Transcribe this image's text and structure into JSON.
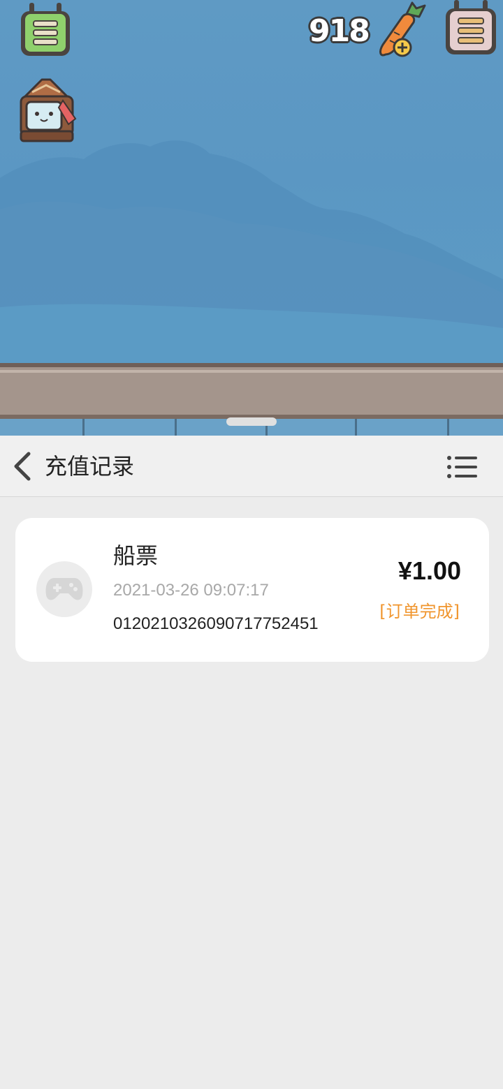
{
  "game": {
    "coins": "918",
    "icons": {
      "left_menu": "notebook-menu-icon",
      "right_menu": "notebook-menu-icon",
      "carrot": "carrot-add-icon",
      "mascot": "lantern-mascot-icon"
    }
  },
  "header": {
    "title": "充值记录",
    "back_icon": "chevron-left-icon",
    "menu_icon": "list-menu-icon"
  },
  "records": [
    {
      "name": "船票",
      "time": "2021-03-26 09:07:17",
      "order_no": "012021032609071775245​1",
      "amount": "¥1.00",
      "status": "[订单完成]",
      "icon": "gamepad-icon"
    }
  ],
  "colors": {
    "status": "#f0952d",
    "sky": "#5b97c3",
    "deck": "#a4958c"
  }
}
